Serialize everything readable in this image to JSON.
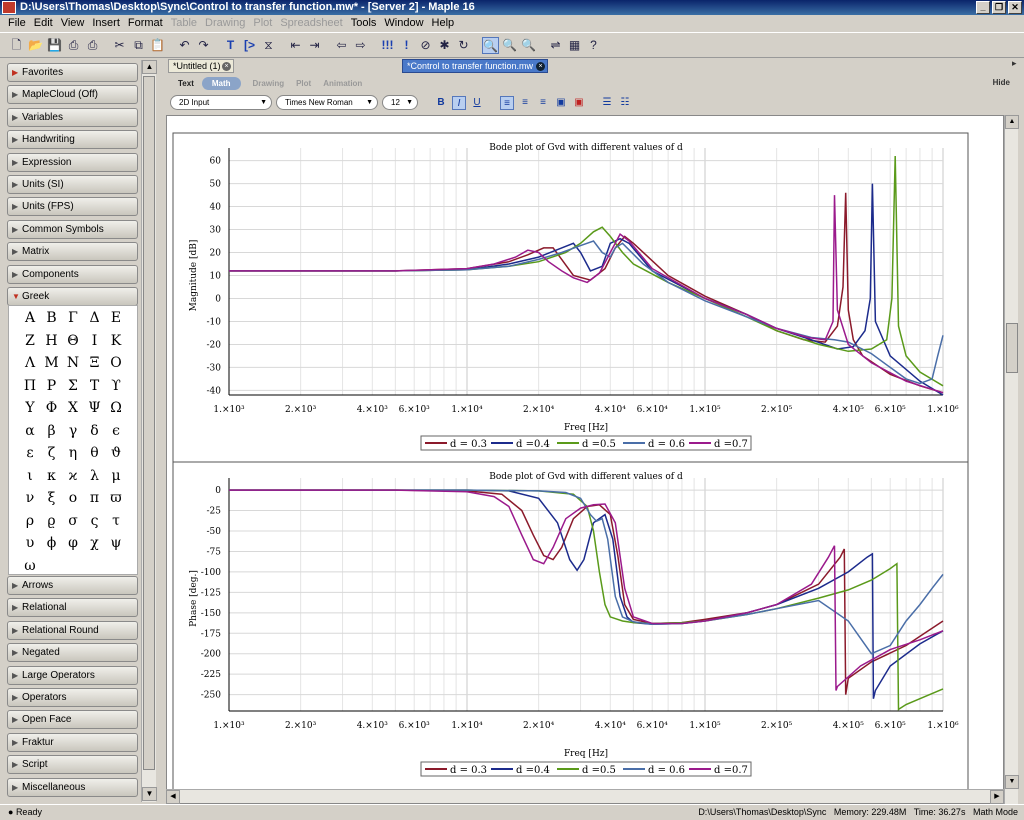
{
  "window": {
    "title": "D:\\Users\\Thomas\\Desktop\\Sync\\Control to transfer function.mw* - [Server 2] - Maple 16",
    "controls": [
      "_",
      "❐",
      "✕"
    ]
  },
  "menu": [
    "File",
    "Edit",
    "View",
    "Insert",
    "Format",
    "Table",
    "Drawing",
    "Plot",
    "Spreadsheet",
    "Tools",
    "Window",
    "Help"
  ],
  "menu_disabled": [
    "Table",
    "Drawing",
    "Plot",
    "Spreadsheet"
  ],
  "toolbar_icons": [
    "new-icon",
    "open-icon",
    "save-icon",
    "print-icon",
    "print-preview-icon",
    "cut-icon",
    "copy-icon",
    "paste-icon",
    "undo-icon",
    "redo-icon",
    "text-mode-icon",
    "math-prompt-icon",
    "section-icon",
    "collapse-icon",
    "expand-icon",
    "back-icon",
    "forward-icon",
    "execute-all-icon",
    "execute-icon",
    "stop-icon",
    "debug-icon",
    "restart-icon",
    "zoom-100-icon",
    "zoom-in-icon",
    "zoom-out-icon",
    "toggle-icon",
    "tutor-icon",
    "help-icon"
  ],
  "palettes": {
    "headers_top": [
      "Favorites",
      "MapleCloud (Off)",
      "Variables",
      "Handwriting",
      "Expression",
      "Units (SI)",
      "Units (FPS)",
      "Common Symbols",
      "Matrix",
      "Components",
      "Greek"
    ],
    "greek_symbols": [
      "Α",
      "Β",
      "Γ",
      "Δ",
      "Ε",
      "Ζ",
      "Η",
      "Θ",
      "Ι",
      "Κ",
      "Λ",
      "Μ",
      "Ν",
      "Ξ",
      "Ο",
      "Π",
      "Ρ",
      "Σ",
      "Τ",
      "ϒ",
      "Υ",
      "Φ",
      "Χ",
      "Ψ",
      "Ω",
      "α",
      "β",
      "γ",
      "δ",
      "ϵ",
      "ε",
      "ζ",
      "η",
      "θ",
      "ϑ",
      "ι",
      "κ",
      "ϰ",
      "λ",
      "μ",
      "ν",
      "ξ",
      "ο",
      "π",
      "ϖ",
      "ρ",
      "ϱ",
      "σ",
      "ς",
      "τ",
      "υ",
      "ϕ",
      "φ",
      "χ",
      "ψ",
      "ω"
    ],
    "headers_bottom": [
      "Arrows",
      "Relational",
      "Relational Round",
      "Negated",
      "Large Operators",
      "Operators",
      "Open Face",
      "Fraktur",
      "Script",
      "Miscellaneous"
    ]
  },
  "tabs": {
    "inactive": "*Untitled (1)",
    "active": "*Control to transfer function.mw"
  },
  "modebar": {
    "items": [
      "Text",
      "Math",
      "Drawing",
      "Plot",
      "Animation"
    ],
    "hide": "Hide"
  },
  "format": {
    "input_mode": "2D Input",
    "font": "Times New Roman",
    "size": "12",
    "bold": "B",
    "italic": "I",
    "underline": "U"
  },
  "status": {
    "left": "Ready",
    "path": "D:\\Users\\Thomas\\Desktop\\Sync",
    "memory": "Memory: 229.48M",
    "time": "Time: 36.27s",
    "mode": "Math Mode"
  },
  "colors": {
    "d03": "#8b1a2b",
    "d04": "#1c2b8c",
    "d05": "#5a9a1a",
    "d06": "#4a6ea8",
    "d07": "#9b1a8c"
  },
  "chart_data": [
    {
      "type": "line",
      "title": "Bode plot of Gvd with  different values of d",
      "xlabel": "Freq [Hz]",
      "ylabel": "Magnitude [dB]",
      "xscale": "log",
      "xlim": [
        1000,
        1000000
      ],
      "ylim": [
        -42,
        62
      ],
      "yticks": [
        60,
        50,
        40,
        30,
        20,
        10,
        0,
        -10,
        -20,
        -30,
        -40
      ],
      "xticks": [
        1000,
        2000,
        4000,
        6000,
        10000,
        20000,
        40000,
        60000,
        100000,
        200000,
        400000,
        600000,
        1000000
      ],
      "xtick_labels": [
        "1.×10³",
        "2.×10³",
        "4.×10³",
        "6.×10³",
        "1.×10⁴",
        "2.×10⁴",
        "4.×10⁴",
        "6.×10⁴",
        "1.×10⁵",
        "2.×10⁵",
        "4.×10⁵",
        "6.×10⁵",
        "1.×10⁶"
      ],
      "legend": [
        "d = 0.3",
        "d =0.4",
        "d =0.5",
        "d = 0.6",
        "d =0.7"
      ],
      "legend_position": "bottom",
      "grid": true,
      "series": [
        {
          "name": "d = 0.3",
          "x": [
            1000,
            5000,
            10000,
            15000,
            18000,
            21000,
            23000,
            25000,
            28000,
            33000,
            38000,
            42000,
            46000,
            50000,
            70000,
            100000,
            150000,
            200000,
            260000,
            320000,
            360000,
            380000,
            390000,
            400000,
            420000,
            460000,
            600000,
            800000,
            1000000
          ],
          "y": [
            12,
            12,
            13,
            16,
            19,
            22,
            22,
            17,
            10,
            8,
            13,
            22,
            27,
            24,
            10,
            1,
            -7,
            -14,
            -18,
            -19,
            -12,
            5,
            46,
            -5,
            -18,
            -25,
            -33,
            -38,
            -41
          ]
        },
        {
          "name": "d =0.4",
          "x": [
            1000,
            5000,
            10000,
            15000,
            20000,
            25000,
            28000,
            30000,
            33000,
            37000,
            40000,
            44000,
            48000,
            60000,
            100000,
            150000,
            200000,
            280000,
            360000,
            420000,
            470000,
            495000,
            505000,
            520000,
            600000,
            800000,
            1000000
          ],
          "y": [
            12,
            12,
            12.5,
            15,
            18,
            22,
            24,
            20,
            12,
            14,
            24,
            26,
            24,
            12,
            0,
            -7,
            -13,
            -18,
            -22,
            -21,
            -14,
            0,
            50,
            -10,
            -25,
            -36,
            -42
          ]
        },
        {
          "name": "d =0.5",
          "x": [
            1000,
            5000,
            10000,
            15000,
            20000,
            26000,
            30000,
            34000,
            37000,
            40000,
            45000,
            50000,
            70000,
            100000,
            150000,
            200000,
            300000,
            400000,
            500000,
            580000,
            610000,
            630000,
            650000,
            700000,
            800000,
            1000000
          ],
          "y": [
            12,
            12,
            12.5,
            14,
            16,
            20,
            24,
            29,
            31,
            27,
            20,
            15,
            7,
            0,
            -8,
            -14,
            -20,
            -23,
            -22,
            -18,
            0,
            62,
            -12,
            -25,
            -32,
            -38
          ]
        },
        {
          "name": "d = 0.6",
          "x": [
            1000,
            5000,
            10000,
            15000,
            20000,
            25000,
            30000,
            34000,
            37000,
            40000,
            42000,
            45000,
            55000,
            70000,
            100000,
            150000,
            200000,
            280000,
            350000,
            400000,
            500000,
            600000,
            700000,
            800000,
            900000,
            950000,
            1000000
          ],
          "y": [
            12,
            12,
            12.5,
            14,
            17,
            20,
            23,
            25,
            20,
            18,
            22,
            24,
            15,
            7,
            -1,
            -8,
            -13,
            -17,
            -18,
            -19,
            -24,
            -30,
            -35,
            -37,
            -35,
            -25,
            -16
          ]
        },
        {
          "name": "d =0.7",
          "x": [
            1000,
            5000,
            10000,
            13000,
            16000,
            18000,
            20000,
            22000,
            25000,
            28000,
            32000,
            36000,
            40000,
            44000,
            48000,
            60000,
            100000,
            150000,
            200000,
            270000,
            320000,
            345000,
            350000,
            360000,
            400000,
            500000,
            700000,
            1000000
          ],
          "y": [
            12,
            12,
            13,
            15,
            18,
            21,
            20,
            16,
            12,
            9,
            7,
            11,
            20,
            28,
            25,
            13,
            0,
            -7,
            -13,
            -17,
            -18,
            -10,
            45,
            -5,
            -20,
            -28,
            -36,
            -41
          ]
        }
      ]
    },
    {
      "type": "line",
      "title": "Bode plot of Gvd with  different values of d",
      "xlabel": "Freq [Hz]",
      "ylabel": "Phase [deg.]",
      "xscale": "log",
      "xlim": [
        1000,
        1000000
      ],
      "ylim": [
        -270,
        5
      ],
      "yticks": [
        0,
        -25,
        -50,
        -75,
        -100,
        -125,
        -150,
        -175,
        -200,
        -225,
        -250
      ],
      "xticks": [
        1000,
        2000,
        4000,
        6000,
        10000,
        20000,
        40000,
        60000,
        100000,
        200000,
        400000,
        600000,
        1000000
      ],
      "xtick_labels": [
        "1.×10³",
        "2.×10³",
        "4.×10³",
        "6.×10³",
        "1.×10⁴",
        "2.×10⁴",
        "4.×10⁴",
        "6.×10⁴",
        "1.×10⁵",
        "2.×10⁵",
        "4.×10⁵",
        "6.×10⁵",
        "1.×10⁶"
      ],
      "legend": [
        "d = 0.3",
        "d =0.4",
        "d =0.5",
        "d = 0.6",
        "d =0.7"
      ],
      "legend_position": "bottom",
      "grid": true,
      "series": [
        {
          "name": "d = 0.3",
          "x": [
            1000,
            5000,
            10000,
            14000,
            17000,
            19000,
            21000,
            23000,
            25000,
            28000,
            32000,
            36000,
            40000,
            43000,
            46000,
            50000,
            60000,
            80000,
            100000,
            150000,
            200000,
            300000,
            370000,
            385000,
            390000,
            400000,
            500000,
            700000,
            1000000
          ],
          "y": [
            0,
            0,
            -1,
            -5,
            -25,
            -55,
            -80,
            -85,
            -70,
            -35,
            -20,
            -18,
            -30,
            -80,
            -140,
            -158,
            -163,
            -162,
            -158,
            -150,
            -140,
            -115,
            -82,
            -72,
            -250,
            -230,
            -210,
            -190,
            -160
          ]
        },
        {
          "name": "d =0.4",
          "x": [
            1000,
            5000,
            10000,
            15000,
            20000,
            24000,
            27000,
            29000,
            31000,
            34000,
            38000,
            41000,
            44000,
            47000,
            50000,
            60000,
            80000,
            100000,
            150000,
            200000,
            300000,
            400000,
            480000,
            505000,
            510000,
            520000,
            600000,
            800000,
            1000000
          ],
          "y": [
            0,
            0,
            0,
            -1,
            -10,
            -40,
            -85,
            -98,
            -85,
            -40,
            -30,
            -60,
            -130,
            -155,
            -162,
            -164,
            -163,
            -160,
            -150,
            -140,
            -120,
            -100,
            -82,
            -78,
            -255,
            -245,
            -215,
            -188,
            -172
          ]
        },
        {
          "name": "d =0.5",
          "x": [
            1000,
            10000,
            20000,
            28000,
            32000,
            34000,
            36000,
            38000,
            40000,
            45000,
            50000,
            60000,
            80000,
            100000,
            150000,
            200000,
            300000,
            400000,
            500000,
            600000,
            640000,
            650000,
            700000,
            800000,
            1000000
          ],
          "y": [
            0,
            0,
            -1,
            -5,
            -20,
            -50,
            -100,
            -140,
            -155,
            -160,
            -162,
            -163,
            -162,
            -160,
            -152,
            -145,
            -132,
            -122,
            -110,
            -96,
            -90,
            -268,
            -262,
            -255,
            -243
          ]
        },
        {
          "name": "d = 0.6",
          "x": [
            1000,
            10000,
            20000,
            26000,
            30000,
            33000,
            35000,
            37000,
            39000,
            42000,
            45000,
            50000,
            60000,
            80000,
            100000,
            150000,
            200000,
            300000,
            400000,
            500000,
            600000,
            700000,
            800000,
            900000,
            1000000
          ],
          "y": [
            0,
            0,
            -1,
            -3,
            -10,
            -30,
            -38,
            -35,
            -60,
            -130,
            -155,
            -161,
            -164,
            -163,
            -160,
            -152,
            -145,
            -135,
            -160,
            -200,
            -190,
            -160,
            -140,
            -120,
            -103
          ]
        },
        {
          "name": "d =0.7",
          "x": [
            1000,
            5000,
            10000,
            13000,
            15000,
            17000,
            19000,
            21000,
            23000,
            26000,
            30000,
            34000,
            38000,
            42000,
            46000,
            50000,
            60000,
            80000,
            100000,
            150000,
            200000,
            280000,
            330000,
            350000,
            355000,
            360000,
            450000,
            600000,
            800000,
            1000000
          ],
          "y": [
            0,
            0,
            -2,
            -8,
            -20,
            -55,
            -85,
            -90,
            -70,
            -35,
            -22,
            -18,
            -17,
            -40,
            -120,
            -155,
            -163,
            -163,
            -160,
            -150,
            -140,
            -115,
            -82,
            -68,
            -245,
            -240,
            -215,
            -195,
            -183,
            -172
          ]
        }
      ]
    }
  ]
}
